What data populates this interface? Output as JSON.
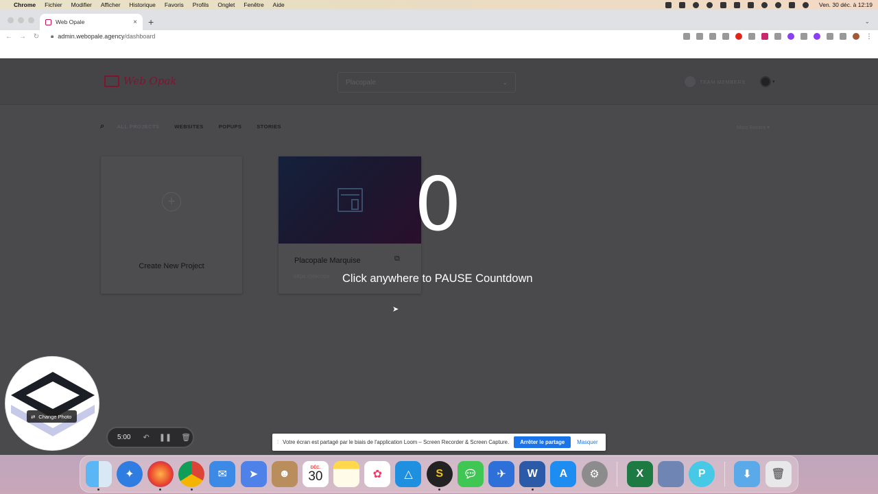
{
  "menubar": {
    "app": "Chrome",
    "items": [
      "Fichier",
      "Modifier",
      "Afficher",
      "Historique",
      "Favoris",
      "Profils",
      "Onglet",
      "Fenêtre",
      "Aide"
    ],
    "clock": "Ven. 30 déc. à 12:19"
  },
  "browser": {
    "tab_title": "Web Opale",
    "url_host": "admin.webopale.agency",
    "url_path": "/dashboard"
  },
  "app": {
    "logo_text": "Web Opak",
    "project_select": "Placopale",
    "team_label": "TEAM MEMBERS",
    "filters": [
      "ALL PROJECTS",
      "WEBSITES",
      "POPUPS",
      "STORIES"
    ],
    "sort_label": "Most Recent",
    "new_project_label": "Create New Project",
    "project_card": {
      "title": "Placopale Marquise",
      "url": "https://placopa"
    }
  },
  "overlay": {
    "countdown": "0",
    "hint": "Click anywhere to PAUSE Countdown"
  },
  "loom": {
    "change_photo": "Change Photo",
    "timer": "5:00",
    "share_text": "Votre écran est partagé par le biais de l'application Loom – Screen Recorder & Screen Capture.",
    "stop_share": "Arrêter le partage",
    "hide": "Masquer"
  },
  "dock": {
    "calendar_month": "DÉC.",
    "calendar_day": "30",
    "apps": [
      "finder",
      "safari",
      "firefox",
      "chrome",
      "mail",
      "maps",
      "contacts",
      "calendar",
      "notes",
      "photos",
      "affinity",
      "scrivener",
      "messages",
      "mail-app",
      "word",
      "app-store",
      "system-preferences",
      "excel",
      "preview",
      "cloud-app",
      "downloads",
      "trash"
    ]
  }
}
